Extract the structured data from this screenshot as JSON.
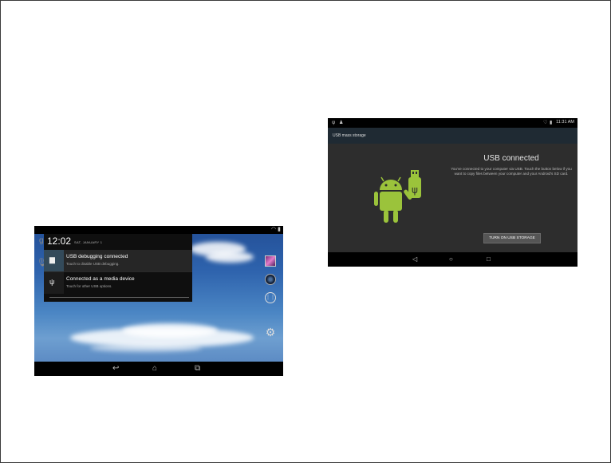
{
  "left_screen": {
    "time": "12:02",
    "date": "SAT, JANUARY 1",
    "notifications": [
      {
        "title": "USB debugging connected",
        "subtitle": "Touch to disable USB debugging."
      },
      {
        "title": "Connected as a media device",
        "subtitle": "Touch for other USB options."
      }
    ]
  },
  "right_screen": {
    "status_time": "11:31 AM",
    "action_bar_title": "USB mass storage",
    "heading": "USB connected",
    "description": "You've connected to your computer via USB. Touch the button below if you want to copy files between your computer and your Android's SD card.",
    "button_label": "TURN ON USB STORAGE"
  },
  "colors": {
    "android_green": "#9bc33b",
    "wallpaper_blue": "#2e63ad",
    "panel_dark": "#2d2d2d"
  }
}
